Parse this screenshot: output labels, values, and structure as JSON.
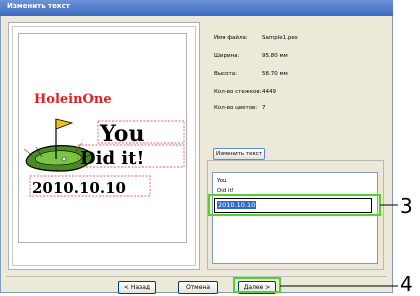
{
  "window": {
    "title": "Изменить текст"
  },
  "info": {
    "rows": [
      {
        "label": "Имя файла:",
        "value": "Sample1.pes"
      },
      {
        "label": "Ширина:",
        "value": "95.80  мм"
      },
      {
        "label": "Высота:",
        "value": "58.70  мм"
      },
      {
        "label": "Кол-во стежков:",
        "value": "4449"
      },
      {
        "label": "Кол-во цветов:",
        "value": "7"
      }
    ]
  },
  "preview": {
    "logo_text": "HoleinOne",
    "line1": "You",
    "line2": "Did it!",
    "line3": "2010.10.10"
  },
  "edit_text_button": "Изменить текст",
  "text_editor": {
    "line1": "You",
    "line2": "Did it!",
    "selected_line": "2010.10.10"
  },
  "buttons": {
    "back": "< Назад",
    "cancel": "Отмена",
    "next": "Далее >"
  },
  "callouts": {
    "editor": "3",
    "next": "4"
  },
  "colors": {
    "highlight": "#55d12f",
    "logo_red": "#e02020",
    "selection": "#316ac5",
    "titlebar": "#3b6bc2"
  }
}
